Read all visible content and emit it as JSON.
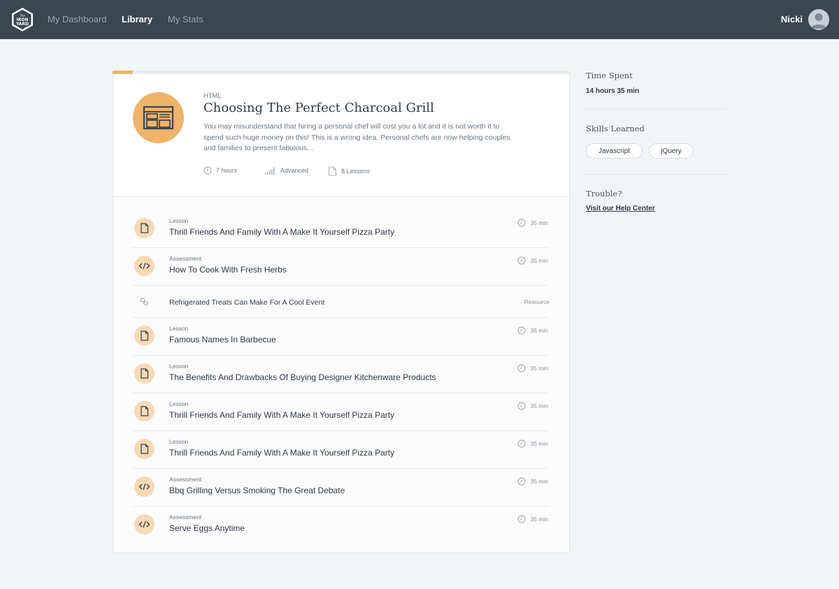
{
  "nav": {
    "logo_text": "THE IRON YARD",
    "links": [
      {
        "label": "My Dashboard"
      },
      {
        "label": "Library"
      },
      {
        "label": "My Stats"
      }
    ],
    "user_name": "Nicki"
  },
  "course": {
    "progress": 0.045,
    "category": "HTML",
    "title": "Choosing The Perfect Charcoal Grill",
    "description": "You may misunderstand that hiring a personal chef will cost you a lot and it is not worth it to spend such huge money on this! This is a wrong idea. Personal chefs are now helping couples and families to present fabulous...",
    "duration": "7 hours",
    "level": "Advanced",
    "lessons": "8 Lessons"
  },
  "items": [
    {
      "type": "Lesson",
      "title": "Thrill Friends And Family With A Make It Yourself Pizza Party",
      "time": "35 min",
      "icon": "document-icon"
    },
    {
      "type": "Assessment",
      "title": "How To Cook With Fresh Herbs",
      "time": "35 min",
      "icon": "code-icon"
    },
    {
      "type": "",
      "title": "Refrigerated Treats Can Make For A Cool Event",
      "time": "Resource",
      "icon": "link-icon"
    },
    {
      "type": "Lesson",
      "title": "Famous Names In Barbecue",
      "time": "35 min",
      "icon": "document-icon"
    },
    {
      "type": "Lesson",
      "title": "The Benefits And Drawbacks Of Buying Designer Kitchenware Products",
      "time": "35 min",
      "icon": "document-icon"
    },
    {
      "type": "Lesson",
      "title": "Thrill Friends And Family With A Make It Yourself Pizza Party",
      "time": "35 min",
      "icon": "document-icon"
    },
    {
      "type": "Lesson",
      "title": "Thrill Friends And Family With A Make It Yourself Pizza Party",
      "time": "35 min",
      "icon": "document-icon"
    },
    {
      "type": "Assessment",
      "title": "Bbq Grilling Versus Smoking The Great Debate",
      "time": "35 min",
      "icon": "code-icon"
    },
    {
      "type": "Assessment",
      "title": "Serve Eggs Anytime",
      "time": "35 min",
      "icon": "code-icon"
    }
  ],
  "sidebar": {
    "time_label": "Time Spent",
    "time_value": "14 hours 35 min",
    "skills_label": "Skills Learned",
    "skills": [
      "Javascript",
      "jQuery"
    ],
    "trouble_label": "Trouble?",
    "help_link": "Visit our Help Center"
  },
  "colors": {
    "accent": "#efb36a",
    "accent_light": "#f7d9b4",
    "nav_bg": "#3a4650"
  }
}
